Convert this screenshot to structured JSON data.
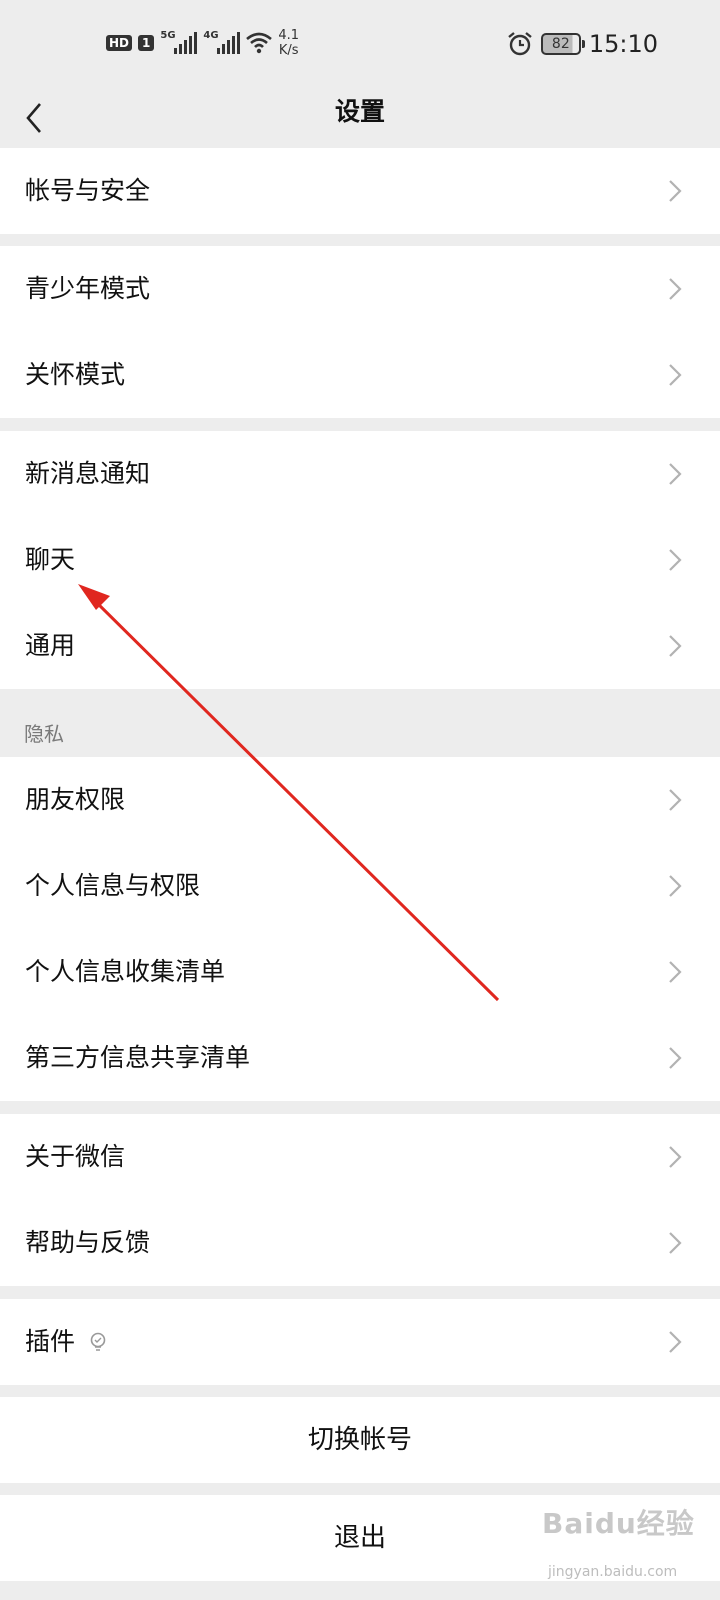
{
  "status_bar": {
    "hd": "HD",
    "sim": "1",
    "net1": "5G",
    "net2": "4G",
    "speed_value": "4.1",
    "speed_unit": "K/s",
    "battery": "82",
    "time": "15:10"
  },
  "nav": {
    "title": "设置"
  },
  "groups": {
    "account": {
      "items": [
        {
          "label": "帐号与安全"
        }
      ]
    },
    "modes": {
      "items": [
        {
          "label": "青少年模式"
        },
        {
          "label": "关怀模式"
        }
      ]
    },
    "general": {
      "items": [
        {
          "label": "新消息通知"
        },
        {
          "label": "聊天"
        },
        {
          "label": "通用"
        }
      ]
    },
    "privacy": {
      "title": "隐私",
      "items": [
        {
          "label": "朋友权限"
        },
        {
          "label": "个人信息与权限"
        },
        {
          "label": "个人信息收集清单"
        },
        {
          "label": "第三方信息共享清单"
        }
      ]
    },
    "about": {
      "items": [
        {
          "label": "关于微信"
        },
        {
          "label": "帮助与反馈"
        }
      ]
    },
    "plugins": {
      "items": [
        {
          "label": "插件"
        }
      ]
    }
  },
  "buttons": {
    "switch_account": "切换帐号",
    "logout": "退出"
  },
  "watermark": {
    "logo": "Baidu经验",
    "url": "jingyan.baidu.com"
  },
  "colors": {
    "annotation_arrow": "#e0271f",
    "background": "#ededed",
    "row": "#ffffff"
  }
}
